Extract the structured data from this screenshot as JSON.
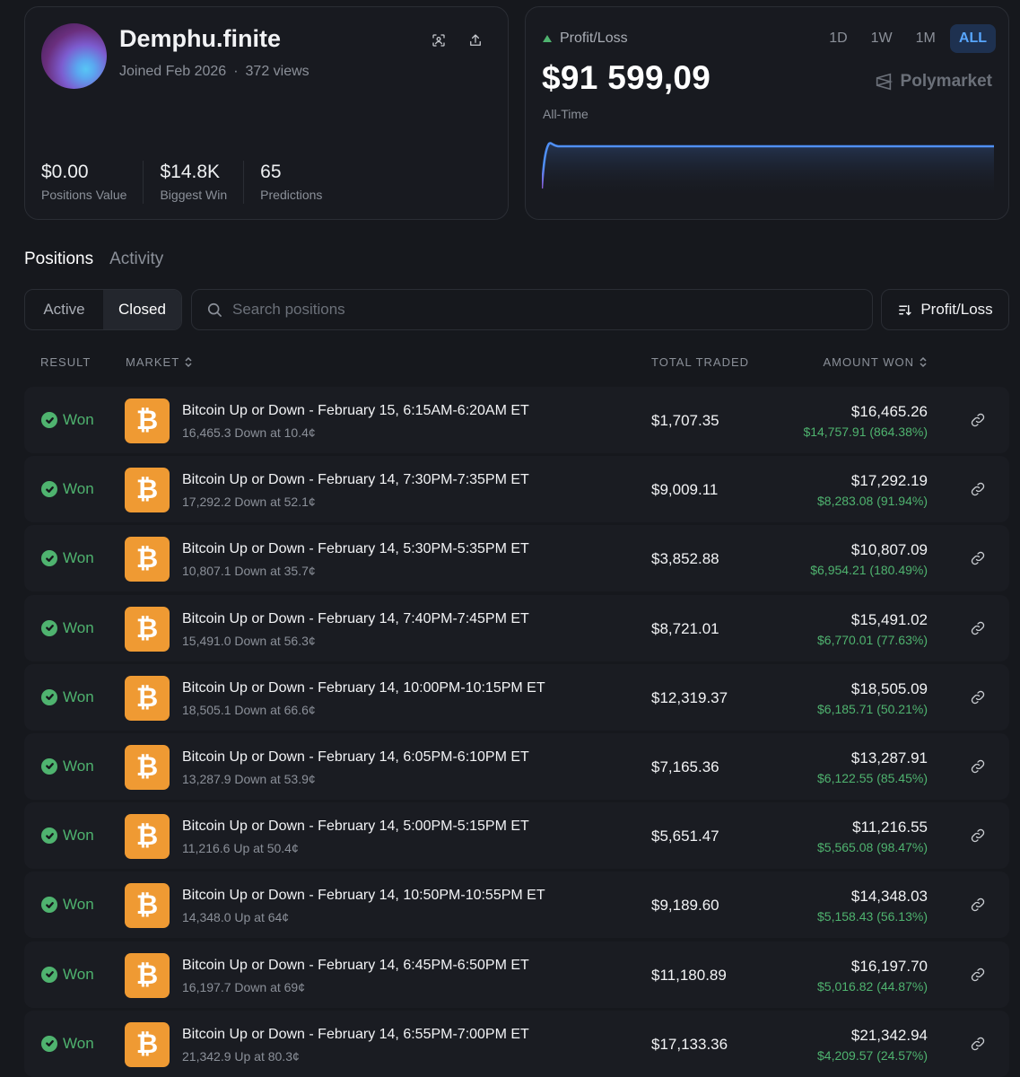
{
  "profile": {
    "username": "Demphu.finite",
    "joined": "Joined Feb 2026",
    "separator": "·",
    "views": "372 views",
    "stats": [
      {
        "value": "$0.00",
        "label": "Positions Value"
      },
      {
        "value": "$14.8K",
        "label": "Biggest Win"
      },
      {
        "value": "65",
        "label": "Predictions"
      }
    ]
  },
  "pnl": {
    "label": "Profit/Loss",
    "value": "$91 599,09",
    "period": "All-Time",
    "timeframes": [
      "1D",
      "1W",
      "1M",
      "ALL"
    ],
    "active_timeframe": "ALL",
    "brand": "Polymarket",
    "colors": {
      "line": "#4f8ff5",
      "positive": "#4fb36f"
    }
  },
  "tabs": {
    "positions": "Positions",
    "activity": "Activity",
    "active": "Positions"
  },
  "filter": {
    "active": "Active",
    "closed": "Closed",
    "selected": "Closed"
  },
  "search": {
    "placeholder": "Search positions",
    "value": ""
  },
  "sort": {
    "label": "Profit/Loss"
  },
  "table": {
    "headers": {
      "result": "RESULT",
      "market": "MARKET",
      "traded": "TOTAL TRADED",
      "won": "AMOUNT WON"
    },
    "rows": [
      {
        "result": "Won",
        "title": "Bitcoin Up or Down - February 15, 6:15AM-6:20AM ET",
        "sub": "16,465.3 Down at 10.4¢",
        "traded": "$1,707.35",
        "won": "$16,465.26",
        "pnl": "$14,757.91 (864.38%)"
      },
      {
        "result": "Won",
        "title": "Bitcoin Up or Down - February 14, 7:30PM-7:35PM ET",
        "sub": "17,292.2 Down at 52.1¢",
        "traded": "$9,009.11",
        "won": "$17,292.19",
        "pnl": "$8,283.08 (91.94%)"
      },
      {
        "result": "Won",
        "title": "Bitcoin Up or Down - February 14, 5:30PM-5:35PM ET",
        "sub": "10,807.1 Down at 35.7¢",
        "traded": "$3,852.88",
        "won": "$10,807.09",
        "pnl": "$6,954.21 (180.49%)"
      },
      {
        "result": "Won",
        "title": "Bitcoin Up or Down - February 14, 7:40PM-7:45PM ET",
        "sub": "15,491.0 Down at 56.3¢",
        "traded": "$8,721.01",
        "won": "$15,491.02",
        "pnl": "$6,770.01 (77.63%)"
      },
      {
        "result": "Won",
        "title": "Bitcoin Up or Down - February 14, 10:00PM-10:15PM ET",
        "sub": "18,505.1 Down at 66.6¢",
        "traded": "$12,319.37",
        "won": "$18,505.09",
        "pnl": "$6,185.71 (50.21%)"
      },
      {
        "result": "Won",
        "title": "Bitcoin Up or Down - February 14, 6:05PM-6:10PM ET",
        "sub": "13,287.9 Down at 53.9¢",
        "traded": "$7,165.36",
        "won": "$13,287.91",
        "pnl": "$6,122.55 (85.45%)"
      },
      {
        "result": "Won",
        "title": "Bitcoin Up or Down - February 14, 5:00PM-5:15PM ET",
        "sub": "11,216.6 Up at 50.4¢",
        "traded": "$5,651.47",
        "won": "$11,216.55",
        "pnl": "$5,565.08 (98.47%)"
      },
      {
        "result": "Won",
        "title": "Bitcoin Up or Down - February 14, 10:50PM-10:55PM ET",
        "sub": "14,348.0 Up at 64¢",
        "traded": "$9,189.60",
        "won": "$14,348.03",
        "pnl": "$5,158.43 (56.13%)"
      },
      {
        "result": "Won",
        "title": "Bitcoin Up or Down - February 14, 6:45PM-6:50PM ET",
        "sub": "16,197.7 Down at 69¢",
        "traded": "$11,180.89",
        "won": "$16,197.70",
        "pnl": "$5,016.82 (44.87%)"
      },
      {
        "result": "Won",
        "title": "Bitcoin Up or Down - February 14, 6:55PM-7:00PM ET",
        "sub": "21,342.9 Up at 80.3¢",
        "traded": "$17,133.36",
        "won": "$21,342.94",
        "pnl": "$4,209.57 (24.57%)"
      }
    ]
  },
  "icons": {
    "scan": "scan-icon",
    "share": "share-icon",
    "search": "search-icon",
    "sort": "sort-icon",
    "link": "link-icon",
    "check": "check-circle-icon",
    "bitcoin": "bitcoin-icon"
  }
}
